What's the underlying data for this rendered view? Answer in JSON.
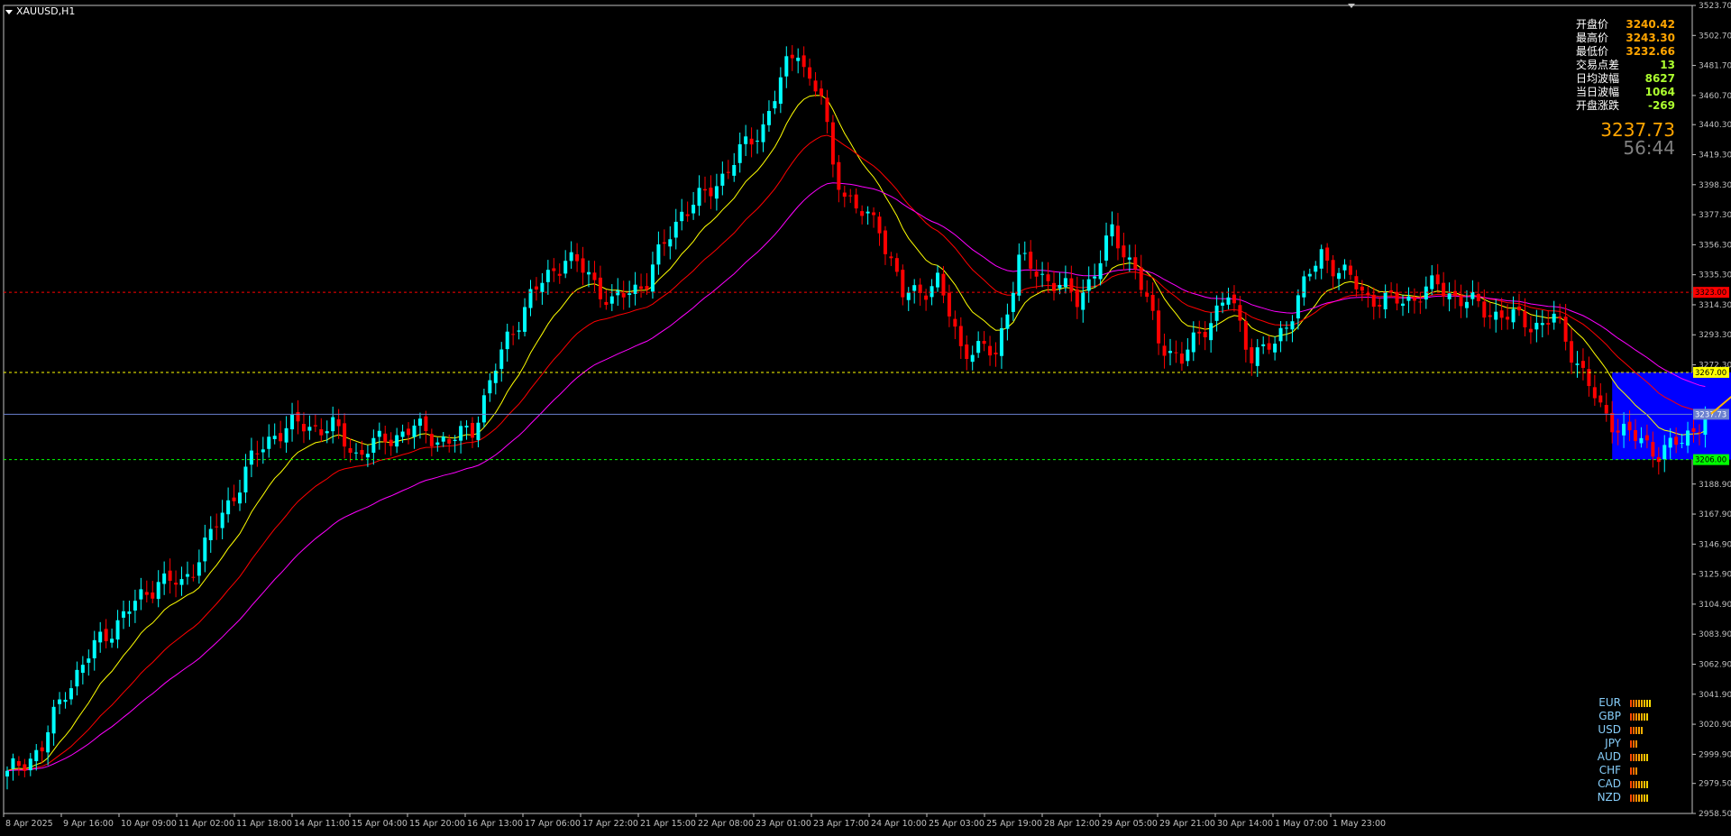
{
  "symbol": "XAUUSD,H1",
  "info_panel": [
    {
      "label": "开盘价",
      "value": "3240.42",
      "color": "#ffa500"
    },
    {
      "label": "最高价",
      "value": "3243.30",
      "color": "#ffa500"
    },
    {
      "label": "最低价",
      "value": "3232.66",
      "color": "#ffa500"
    },
    {
      "label": "交易点差",
      "value": "13",
      "color": "#adff2f"
    },
    {
      "label": "日均波幅",
      "value": "8627",
      "color": "#adff2f"
    },
    {
      "label": "当日波幅",
      "value": "1064",
      "color": "#adff2f"
    },
    {
      "label": "开盘涨跌",
      "value": "-269",
      "color": "#adff2f"
    }
  ],
  "current_price": "3237.73",
  "timer": "56:44",
  "currency_strength": [
    {
      "name": "EUR",
      "bars": 8
    },
    {
      "name": "GBP",
      "bars": 7
    },
    {
      "name": "USD",
      "bars": 5
    },
    {
      "name": "JPY",
      "bars": 3
    },
    {
      "name": "AUD",
      "bars": 7
    },
    {
      "name": "CHF",
      "bars": 3
    },
    {
      "name": "CAD",
      "bars": 7
    },
    {
      "name": "NZD",
      "bars": 7
    }
  ],
  "chart_data": {
    "type": "candlestick",
    "symbol": "XAUUSD",
    "timeframe": "H1",
    "ylim": [
      2958.5,
      3523.7
    ],
    "y_ticks": [
      "3523.70",
      "3502.70",
      "3481.70",
      "3460.70",
      "3440.30",
      "3419.30",
      "3398.30",
      "3377.30",
      "3356.30",
      "3335.30",
      "3314.30",
      "3293.30",
      "3272.30",
      "3251.30",
      "3230.30",
      "3209.30",
      "3188.90",
      "3167.90",
      "3146.90",
      "3125.90",
      "3104.90",
      "3083.90",
      "3062.90",
      "3041.90",
      "3020.90",
      "2999.90",
      "2979.50",
      "2958.50"
    ],
    "x_labels": [
      "8 Apr 2025",
      "9 Apr 16:00",
      "10 Apr 09:00",
      "11 Apr 02:00",
      "11 Apr 18:00",
      "14 Apr 11:00",
      "15 Apr 04:00",
      "15 Apr 20:00",
      "16 Apr 13:00",
      "17 Apr 06:00",
      "17 Apr 22:00",
      "21 Apr 15:00",
      "22 Apr 08:00",
      "23 Apr 01:00",
      "23 Apr 17:00",
      "24 Apr 10:00",
      "25 Apr 03:00",
      "25 Apr 19:00",
      "28 Apr 12:00",
      "29 Apr 05:00",
      "29 Apr 21:00",
      "30 Apr 14:00",
      "1 May 07:00",
      "1 May 23:00"
    ],
    "anchors": [
      [
        0,
        2985
      ],
      [
        6,
        3005
      ],
      [
        10,
        3045
      ],
      [
        16,
        3080
      ],
      [
        22,
        3105
      ],
      [
        26,
        3122
      ],
      [
        30,
        3118
      ],
      [
        36,
        3160
      ],
      [
        42,
        3205
      ],
      [
        46,
        3225
      ],
      [
        50,
        3230
      ],
      [
        56,
        3228
      ],
      [
        60,
        3210
      ],
      [
        66,
        3222
      ],
      [
        70,
        3228
      ],
      [
        76,
        3218
      ],
      [
        80,
        3228
      ],
      [
        86,
        3290
      ],
      [
        90,
        3320
      ],
      [
        96,
        3348
      ],
      [
        100,
        3335
      ],
      [
        104,
        3315
      ],
      [
        110,
        3332
      ],
      [
        116,
        3380
      ],
      [
        120,
        3390
      ],
      [
        126,
        3420
      ],
      [
        130,
        3440
      ],
      [
        134,
        3480
      ],
      [
        136,
        3495
      ],
      [
        138,
        3470
      ],
      [
        140,
        3460
      ],
      [
        142,
        3410
      ],
      [
        146,
        3380
      ],
      [
        150,
        3370
      ],
      [
        154,
        3320
      ],
      [
        160,
        3330
      ],
      [
        164,
        3285
      ],
      [
        170,
        3280
      ],
      [
        174,
        3345
      ],
      [
        180,
        3330
      ],
      [
        184,
        3318
      ],
      [
        188,
        3345
      ],
      [
        190,
        3365
      ],
      [
        194,
        3340
      ],
      [
        198,
        3290
      ],
      [
        202,
        3275
      ],
      [
        206,
        3300
      ],
      [
        210,
        3320
      ],
      [
        214,
        3280
      ],
      [
        218,
        3285
      ],
      [
        222,
        3320
      ],
      [
        226,
        3350
      ],
      [
        230,
        3335
      ],
      [
        234,
        3320
      ],
      [
        238,
        3316
      ],
      [
        242,
        3320
      ],
      [
        246,
        3328
      ],
      [
        250,
        3318
      ],
      [
        256,
        3308
      ],
      [
        260,
        3304
      ],
      [
        264,
        3300
      ],
      [
        266,
        3305
      ],
      [
        270,
        3275
      ],
      [
        274,
        3240
      ],
      [
        280,
        3220
      ],
      [
        284,
        3212
      ],
      [
        288,
        3218
      ],
      [
        292,
        3238
      ]
    ],
    "moving_averages": [
      {
        "color": "#ffff00",
        "period": "short"
      },
      {
        "color": "#ff0000",
        "period": "medium"
      },
      {
        "color": "#ff00ff",
        "period": "long"
      }
    ],
    "horizontal_lines": [
      {
        "price": 3323.0,
        "label": "3323.00",
        "color": "#ff0000"
      },
      {
        "price": 3267.0,
        "label": "3267.00",
        "color": "#ffff00"
      },
      {
        "price": 3237.73,
        "label": "3237.73",
        "color": "#6a7fcf"
      },
      {
        "price": 3206.0,
        "label": "3206.00",
        "color": "#00ff00"
      }
    ],
    "zone": {
      "from_index": 276,
      "to_index": 317,
      "top": 3267,
      "bottom": 3206,
      "color": "#0000ff"
    },
    "projection": [
      [
        293,
        3238
      ],
      [
        300,
        3262
      ],
      [
        315,
        3208
      ]
    ],
    "bar_count": 293,
    "up_color": "#00ffff",
    "down_color": "#ff0000"
  }
}
